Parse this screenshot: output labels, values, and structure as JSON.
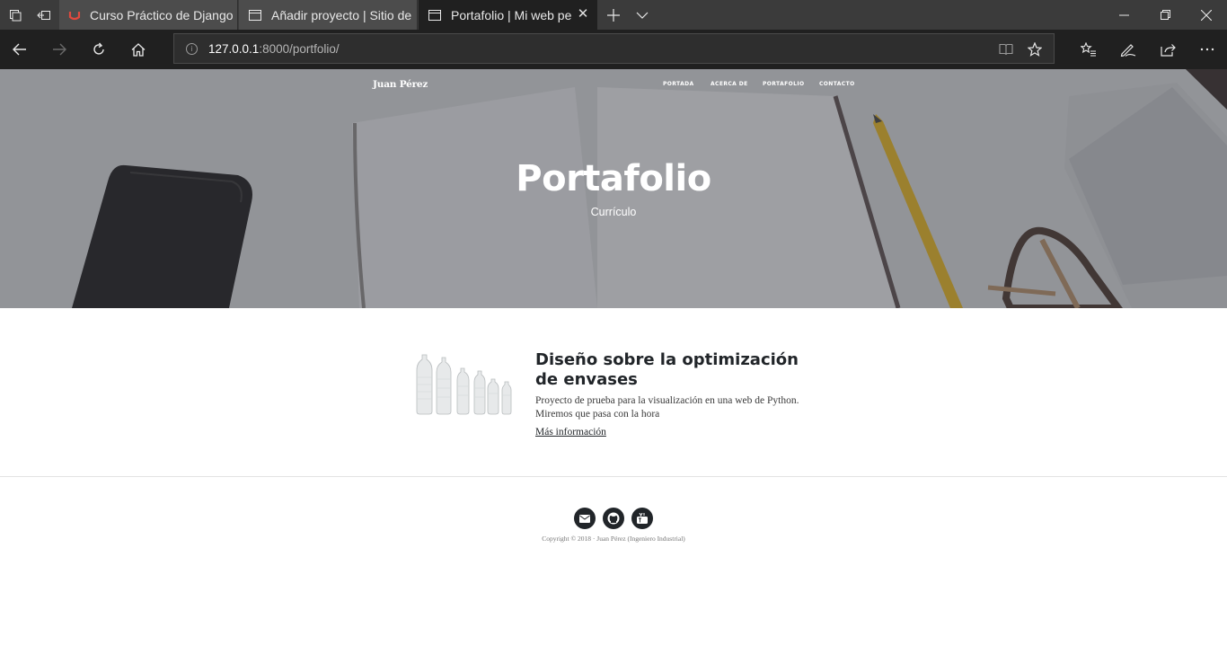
{
  "browser": {
    "tabs": [
      {
        "title": "Curso Práctico de Django: A",
        "active": false,
        "icon": "udemy-icon"
      },
      {
        "title": "Añadir proyecto | Sitio de a",
        "active": false,
        "icon": "page-icon"
      },
      {
        "title": "Portafolio | Mi web pers",
        "active": true,
        "icon": "page-icon"
      }
    ],
    "address": {
      "host": "127.0.0.1",
      "rest": ":8000/portfolio/"
    }
  },
  "site": {
    "brand": "Juan Pérez",
    "nav": [
      "PORTADA",
      "ACERCA DE",
      "PORTAFOLIO",
      "CONTACTO"
    ],
    "hero": {
      "title": "Portafolio",
      "subtitle": "Currículo"
    },
    "project": {
      "title": "Diseño sobre la optimización de envases",
      "description_line1": "Proyecto de prueba para la visualización en una web de Python.",
      "description_line2": "Miremos que pasa con la hora",
      "link": "Más información"
    },
    "footer": {
      "social_icons": [
        "email-icon",
        "github-icon",
        "youtube-icon"
      ],
      "copyright": "Copyright © 2018 · Juan Pérez (Ingeniero Industrial)"
    }
  },
  "colors": {
    "tabbar": "#3b3b3b",
    "active_tab": "#202020",
    "hero_overlay": "#34373e",
    "text_dark": "#212529"
  }
}
